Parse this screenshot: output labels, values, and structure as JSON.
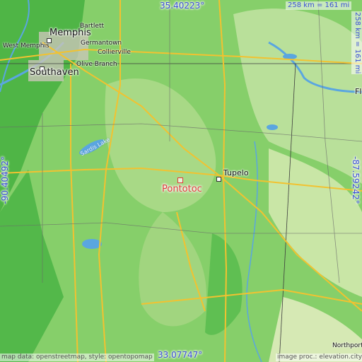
{
  "map": {
    "place": "Pontotoc",
    "coords": {
      "top": "35.40223°",
      "bottom": "33.07747°",
      "left": "-90.40492°",
      "right": "-87.59242°"
    },
    "scale": {
      "horizontal": "258 km = 161 mi",
      "vertical": "258 km = 161 mi"
    },
    "cities": {
      "memphis": "Memphis",
      "west_memphis": "West Memphis",
      "southaven": "Southaven",
      "tupelo": "Tupelo",
      "bartlett": "Bartlett",
      "germantown": "Germantown",
      "collierville": "Collierville",
      "olive_branch": "Olive Branch",
      "florence_partial": "Fl",
      "northport_partial": "Northport"
    },
    "lakes": {
      "sardis": "Sardis Lake"
    },
    "attribution": {
      "left": "map data: openstreetmap, style: opentopomap",
      "right": "image proc.: elevation.city"
    },
    "colors": {
      "lowland": "#5fbf52",
      "midland": "#9ed37a",
      "highland": "#cfe6a2",
      "water": "#5aa6e0",
      "roads": "#f2c230",
      "main_marker": "#e23b3b",
      "coord_text": "#3b4fd6"
    }
  }
}
